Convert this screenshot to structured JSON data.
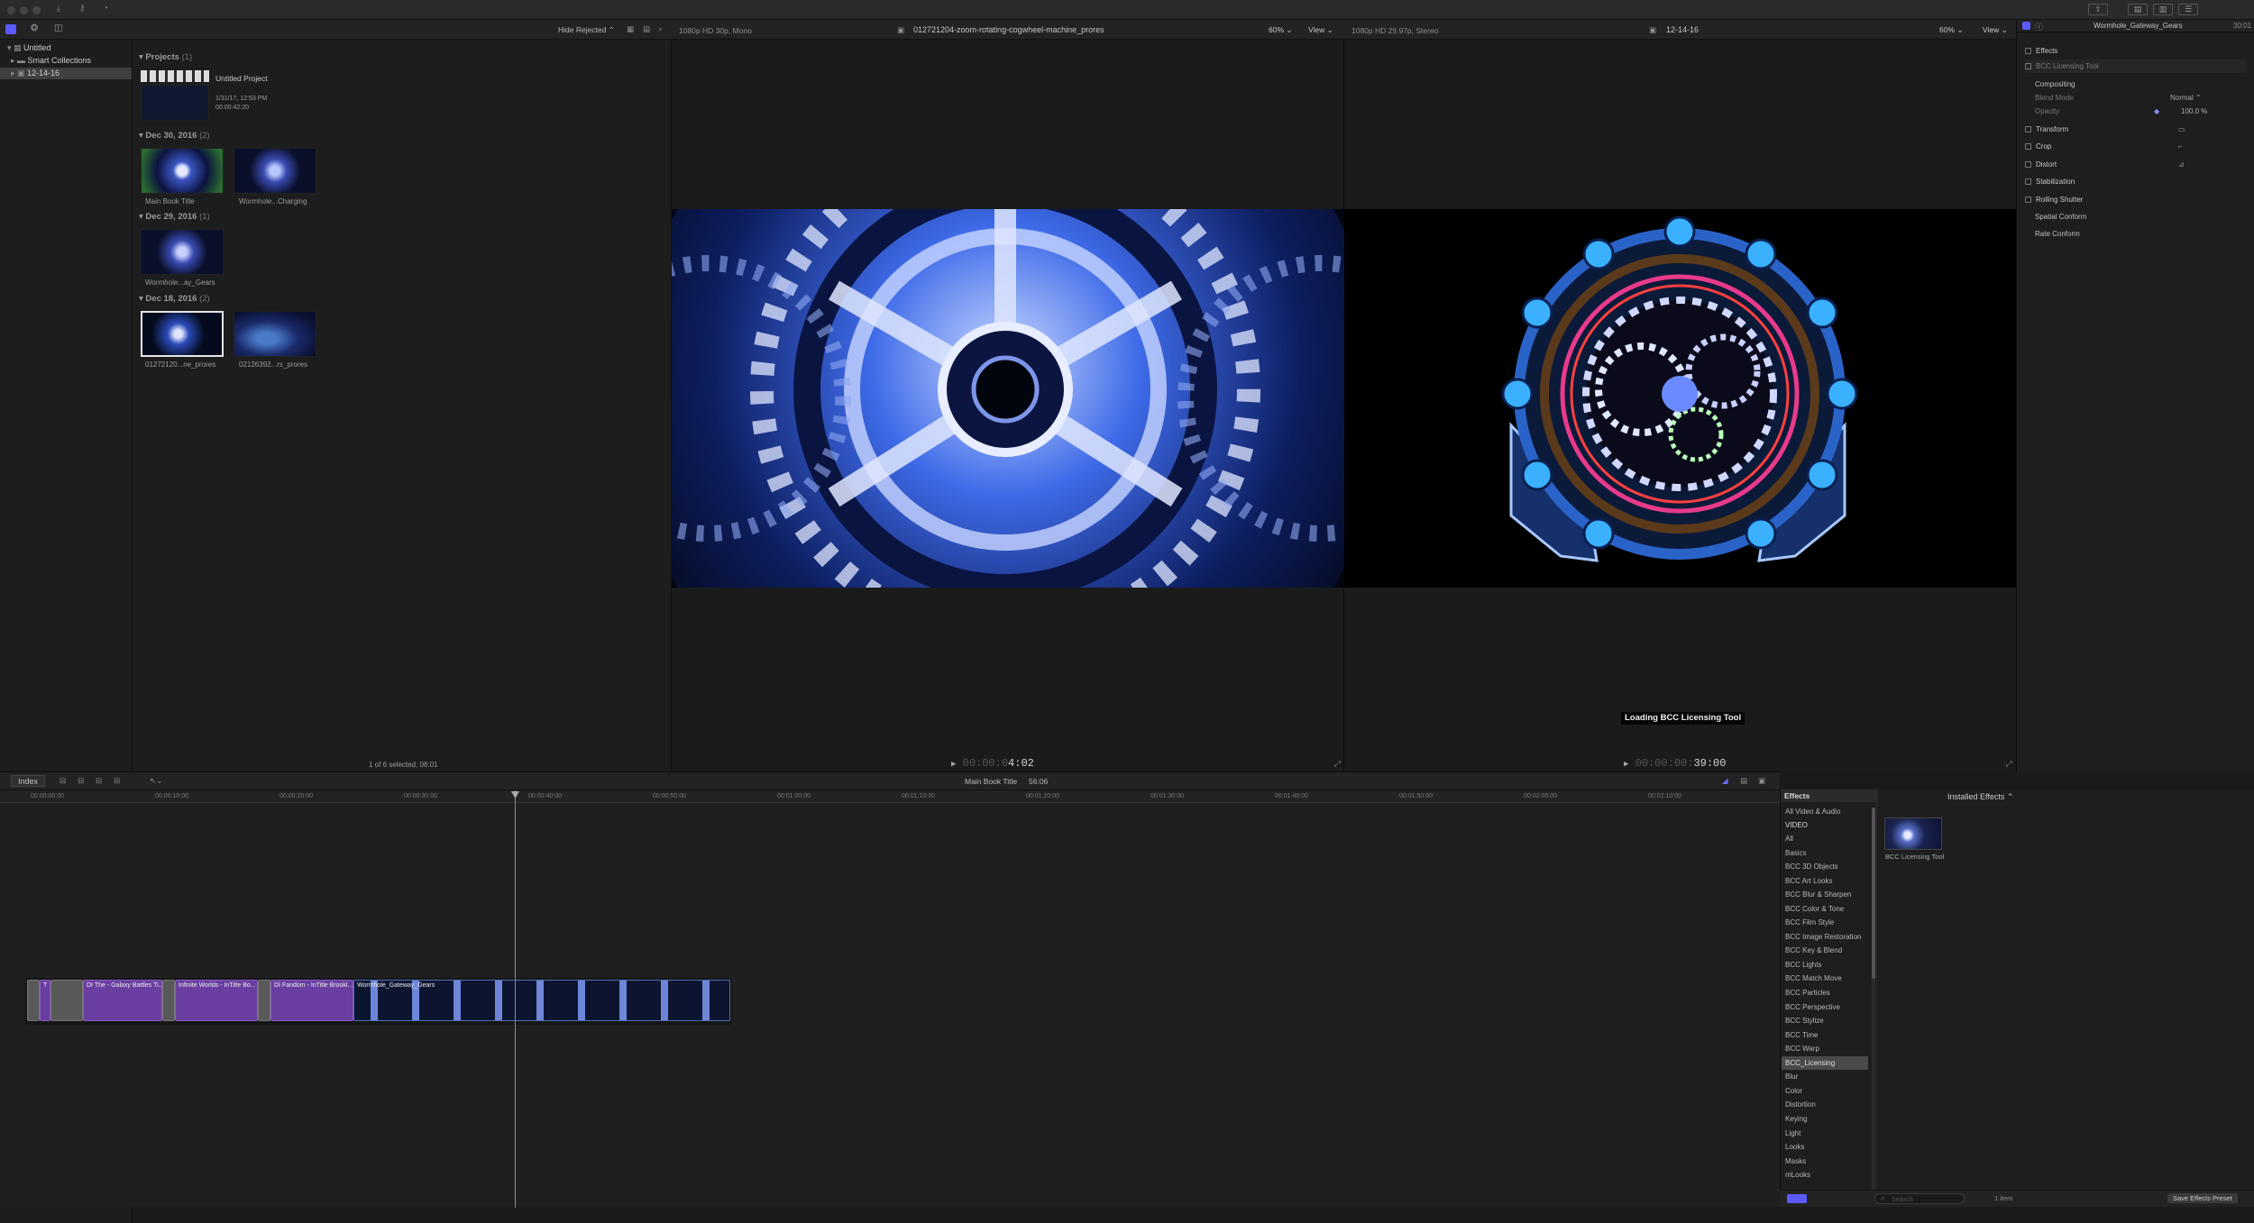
{
  "toolbar": {
    "icons": [
      "back-icon",
      "forward-icon",
      "import-icon",
      "keyword-icon",
      "background-tasks-icon",
      "libraries-icon",
      "photos-icon",
      "titles-icon"
    ],
    "layout_icons": [
      "browser-toggle-icon",
      "timeline-toggle-icon",
      "inspector-toggle-icon"
    ]
  },
  "sidebar": {
    "items": [
      {
        "label": "Untitled",
        "icon": "library-icon"
      },
      {
        "label": "Smart Collections",
        "icon": "folder-icon"
      },
      {
        "label": "12-14-16",
        "icon": "event-icon",
        "selected": true
      }
    ]
  },
  "browser": {
    "filter": "Hide Rejected",
    "groups": [
      {
        "title": "Projects",
        "count": "(1)"
      },
      {
        "title": "Dec 30, 2016",
        "count": "(2)"
      },
      {
        "title": "Dec 29, 2016",
        "count": "(1)"
      },
      {
        "title": "Dec 18, 2016",
        "count": "(2)"
      }
    ],
    "project": {
      "name": "Untitled Project",
      "date": "1/31/17, 12:53 PM",
      "duration": "00:00:42:20"
    },
    "clips": [
      {
        "label": "Main Book Title"
      },
      {
        "label": "Wormhole...Charging"
      },
      {
        "label": "Wormhole...ay_Gears"
      },
      {
        "label": "01272120...ne_prores"
      },
      {
        "label": "02126392...rs_prores"
      }
    ],
    "status": "1 of 6 selected, 08:01"
  },
  "viewer_left": {
    "format": "1080p HD 30p, Mono",
    "clip_name": "012721204-zoom-rotating-cogwheel-machine_prores",
    "zoom": "60%",
    "view": "View",
    "timecode_dim": "00:00:0",
    "timecode": "4:02"
  },
  "viewer_right": {
    "format": "1080p HD 29.97p, Stereo",
    "event": "12-14-16",
    "zoom": "60%",
    "view": "View",
    "overlay": "Loading BCC Licensing Tool",
    "timecode_dim": "00:00:00:",
    "timecode": "39:00"
  },
  "inspector": {
    "title": "Wormhole_Gateway_Gears",
    "time": "30:01",
    "rows": [
      {
        "label": "Effects",
        "check": true
      },
      {
        "label": "BCC Licensing Tool",
        "check": true,
        "dim": true
      },
      {
        "label": "Compositing",
        "check": false
      },
      {
        "label": "Blend Mode",
        "value": "Normal",
        "dim": true
      },
      {
        "label": "Opacity",
        "value": "100.0 %",
        "dim": true
      },
      {
        "label": "Transform",
        "check": true
      },
      {
        "label": "Crop",
        "check": true
      },
      {
        "label": "Distort",
        "check": true
      },
      {
        "label": "Stabilization",
        "check": true
      },
      {
        "label": "Rolling Shutter",
        "check": true
      },
      {
        "label": "Spatial Conform",
        "check": false
      },
      {
        "label": "Rate Conform",
        "check": false
      }
    ]
  },
  "timeline": {
    "index": "Index",
    "title": "Main Book Title",
    "duration": "56:06",
    "ruler": [
      "00:00:00:00",
      "00:00:10:00",
      "00:00:20:00",
      "00:00:30:00",
      "00:00:40:00",
      "00:00:50:00",
      "00:01:00:00",
      "00:01:10:00",
      "00:01:20:00",
      "00:01:30:00",
      "00:01:40:00",
      "00:01:50:00",
      "00:02:00:00",
      "00:02:10:00"
    ],
    "clips": [
      {
        "label": "",
        "kind": "gray"
      },
      {
        "label": "T",
        "kind": "purple"
      },
      {
        "label": "",
        "kind": "gray"
      },
      {
        "label": "DI The - Galaxy Battles Ti...",
        "kind": "purple"
      },
      {
        "label": "",
        "kind": "gray"
      },
      {
        "label": "Infinite Worlds - InTitle Bo...",
        "kind": "purple"
      },
      {
        "label": "",
        "kind": "gray"
      },
      {
        "label": "DI Fandom - InTitle Brookl...",
        "kind": "purple"
      },
      {
        "label": "Wormhole_Gateway_Gears",
        "kind": "blue"
      }
    ]
  },
  "effects_browser": {
    "header": "Effects",
    "installed": "Installed Effects",
    "categories": [
      "All Video & Audio",
      "VIDEO",
      "All",
      "Basics",
      "BCC 3D Objects",
      "BCC Art Looks",
      "BCC Blur & Sharpen",
      "BCC Color & Tone",
      "BCC Film Style",
      "BCC Image Restoration",
      "BCC Key & Blend",
      "BCC Lights",
      "BCC Match Move",
      "BCC Particles",
      "BCC Perspective",
      "BCC Stylize",
      "BCC Time",
      "BCC Warp",
      "BCC_Licensing",
      "Blur",
      "Color",
      "Distortion",
      "Keying",
      "Light",
      "Looks",
      "Masks",
      "mLooks"
    ],
    "selected": "BCC_Licensing",
    "effect_name": "BCC Licensing Tool",
    "search_placeholder": "Search",
    "count": "1 item",
    "save_preset": "Save Effects Preset"
  }
}
